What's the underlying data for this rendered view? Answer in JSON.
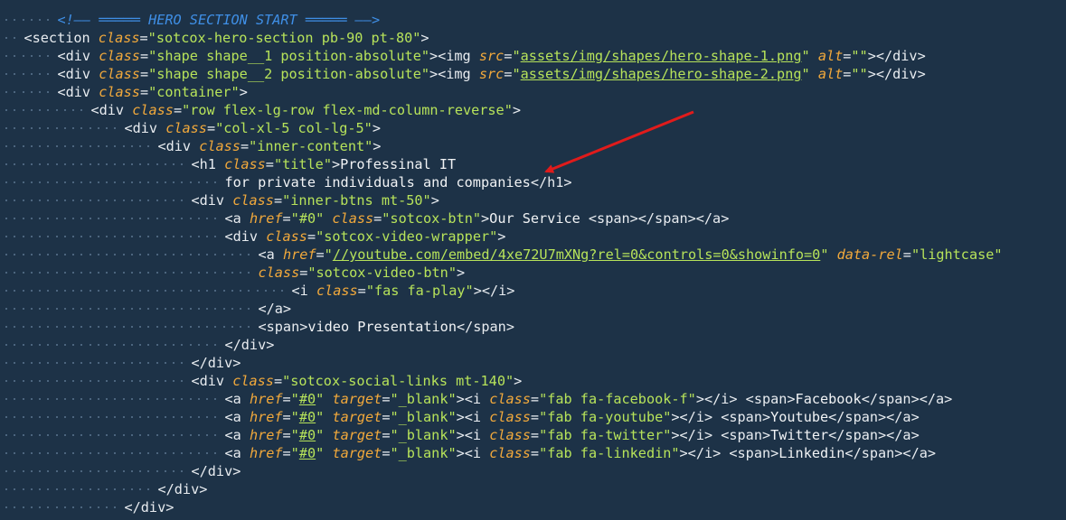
{
  "editor": {
    "lines": [
      [
        [
          "com",
          "<!—— ═════ HERO SECTION START ═════ ——>"
        ]
      ],
      [
        [
          "tag",
          "<section "
        ],
        [
          "attr",
          "class"
        ],
        [
          "tag",
          "="
        ],
        [
          "str",
          "\"sotcox-hero-section pb-90 pt-80\""
        ],
        [
          "tag",
          ">"
        ]
      ],
      [
        [
          "tag",
          "<div "
        ],
        [
          "attr",
          "class"
        ],
        [
          "tag",
          "="
        ],
        [
          "str",
          "\"shape shape__1 position-absolute\""
        ],
        [
          "tag",
          "><img "
        ],
        [
          "attr",
          "src"
        ],
        [
          "tag",
          "="
        ],
        [
          "str",
          "\""
        ],
        [
          "link",
          "assets/img/shapes/hero-shape-1.png"
        ],
        [
          "str",
          "\""
        ],
        [
          "tag",
          " "
        ],
        [
          "attr",
          "alt"
        ],
        [
          "tag",
          "="
        ],
        [
          "str",
          "\"\""
        ],
        [
          "tag",
          "></div>"
        ]
      ],
      [
        [
          "tag",
          "<div "
        ],
        [
          "attr",
          "class"
        ],
        [
          "tag",
          "="
        ],
        [
          "str",
          "\"shape shape__2 position-absolute\""
        ],
        [
          "tag",
          "><img "
        ],
        [
          "attr",
          "src"
        ],
        [
          "tag",
          "="
        ],
        [
          "str",
          "\""
        ],
        [
          "link",
          "assets/img/shapes/hero-shape-2.png"
        ],
        [
          "str",
          "\""
        ],
        [
          "tag",
          " "
        ],
        [
          "attr",
          "alt"
        ],
        [
          "tag",
          "="
        ],
        [
          "str",
          "\"\""
        ],
        [
          "tag",
          "></div>"
        ]
      ],
      [
        [
          "tag",
          "<div "
        ],
        [
          "attr",
          "class"
        ],
        [
          "tag",
          "="
        ],
        [
          "str",
          "\"container\""
        ],
        [
          "tag",
          ">"
        ]
      ],
      [
        [
          "tag",
          "<div "
        ],
        [
          "attr",
          "class"
        ],
        [
          "tag",
          "="
        ],
        [
          "str",
          "\"row flex-lg-row flex-md-column-reverse\""
        ],
        [
          "tag",
          ">"
        ]
      ],
      [
        [
          "tag",
          "<div "
        ],
        [
          "attr",
          "class"
        ],
        [
          "tag",
          "="
        ],
        [
          "str",
          "\"col-xl-5 col-lg-5\""
        ],
        [
          "tag",
          ">"
        ]
      ],
      [
        [
          "tag",
          "<div "
        ],
        [
          "attr",
          "class"
        ],
        [
          "tag",
          "="
        ],
        [
          "str",
          "\"inner-content\""
        ],
        [
          "tag",
          ">"
        ]
      ],
      [
        [
          "tag",
          "<h1 "
        ],
        [
          "attr",
          "class"
        ],
        [
          "tag",
          "="
        ],
        [
          "str",
          "\"title\""
        ],
        [
          "tag",
          ">"
        ],
        [
          "txt",
          "Professinal IT"
        ]
      ],
      [
        [
          "txt",
          "for private individuals and companies"
        ],
        [
          "tag",
          "</h1>"
        ]
      ],
      [
        [
          "tag",
          "<div "
        ],
        [
          "attr",
          "class"
        ],
        [
          "tag",
          "="
        ],
        [
          "str",
          "\"inner-btns mt-50\""
        ],
        [
          "tag",
          ">"
        ]
      ],
      [
        [
          "tag",
          "<a "
        ],
        [
          "attr",
          "href"
        ],
        [
          "tag",
          "="
        ],
        [
          "str",
          "\"#0\""
        ],
        [
          "tag",
          " "
        ],
        [
          "attr",
          "class"
        ],
        [
          "tag",
          "="
        ],
        [
          "str",
          "\"sotcox-btn\""
        ],
        [
          "tag",
          ">"
        ],
        [
          "txt",
          "Our Service "
        ],
        [
          "tag",
          "<span></span></a>"
        ]
      ],
      [
        [
          "tag",
          "<div "
        ],
        [
          "attr",
          "class"
        ],
        [
          "tag",
          "="
        ],
        [
          "str",
          "\"sotcox-video-wrapper\""
        ],
        [
          "tag",
          ">"
        ]
      ],
      [
        [
          "tag",
          "<a "
        ],
        [
          "attr",
          "href"
        ],
        [
          "tag",
          "="
        ],
        [
          "str",
          "\""
        ],
        [
          "link",
          "//youtube.com/embed/4xe72U7mXNg?rel=0&controls=0&showinfo=0"
        ],
        [
          "str",
          "\""
        ],
        [
          "tag",
          " "
        ],
        [
          "attr",
          "data-rel"
        ],
        [
          "tag",
          "="
        ],
        [
          "str",
          "\"lightcase\""
        ]
      ],
      [
        [
          "attr",
          "class"
        ],
        [
          "tag",
          "="
        ],
        [
          "str",
          "\"sotcox-video-btn\""
        ],
        [
          "tag",
          ">"
        ]
      ],
      [
        [
          "tag",
          "<i "
        ],
        [
          "attr",
          "class"
        ],
        [
          "tag",
          "="
        ],
        [
          "str",
          "\"fas fa-play\""
        ],
        [
          "tag",
          "></i>"
        ]
      ],
      [
        [
          "tag",
          "</a>"
        ]
      ],
      [
        [
          "tag",
          "<span>"
        ],
        [
          "txt",
          "video Presentation"
        ],
        [
          "tag",
          "</span>"
        ]
      ],
      [
        [
          "tag",
          "</div>"
        ]
      ],
      [
        [
          "tag",
          "</div>"
        ]
      ],
      [
        [
          "tag",
          "<div "
        ],
        [
          "attr",
          "class"
        ],
        [
          "tag",
          "="
        ],
        [
          "str",
          "\"sotcox-social-links mt-140\""
        ],
        [
          "tag",
          ">"
        ]
      ],
      [
        [
          "tag",
          "<a "
        ],
        [
          "attr",
          "href"
        ],
        [
          "tag",
          "="
        ],
        [
          "str",
          "\""
        ],
        [
          "link",
          "#0"
        ],
        [
          "str",
          "\""
        ],
        [
          "tag",
          " "
        ],
        [
          "attr",
          "target"
        ],
        [
          "tag",
          "="
        ],
        [
          "str",
          "\"_blank\""
        ],
        [
          "tag",
          "><i "
        ],
        [
          "attr",
          "class"
        ],
        [
          "tag",
          "="
        ],
        [
          "str",
          "\"fab fa-facebook-f\""
        ],
        [
          "tag",
          "></i> <span>"
        ],
        [
          "txt",
          "Facebook"
        ],
        [
          "tag",
          "</span></a>"
        ]
      ],
      [
        [
          "tag",
          "<a "
        ],
        [
          "attr",
          "href"
        ],
        [
          "tag",
          "="
        ],
        [
          "str",
          "\""
        ],
        [
          "link",
          "#0"
        ],
        [
          "str",
          "\""
        ],
        [
          "tag",
          " "
        ],
        [
          "attr",
          "target"
        ],
        [
          "tag",
          "="
        ],
        [
          "str",
          "\"_blank\""
        ],
        [
          "tag",
          "><i "
        ],
        [
          "attr",
          "class"
        ],
        [
          "tag",
          "="
        ],
        [
          "str",
          "\"fab fa-youtube\""
        ],
        [
          "tag",
          "></i> <span>"
        ],
        [
          "txt",
          "Youtube"
        ],
        [
          "tag",
          "</span></a>"
        ]
      ],
      [
        [
          "tag",
          "<a "
        ],
        [
          "attr",
          "href"
        ],
        [
          "tag",
          "="
        ],
        [
          "str",
          "\""
        ],
        [
          "link",
          "#0"
        ],
        [
          "str",
          "\""
        ],
        [
          "tag",
          " "
        ],
        [
          "attr",
          "target"
        ],
        [
          "tag",
          "="
        ],
        [
          "str",
          "\"_blank\""
        ],
        [
          "tag",
          "><i "
        ],
        [
          "attr",
          "class"
        ],
        [
          "tag",
          "="
        ],
        [
          "str",
          "\"fab fa-twitter\""
        ],
        [
          "tag",
          "></i> <span>"
        ],
        [
          "txt",
          "Twitter"
        ],
        [
          "tag",
          "</span></a>"
        ]
      ],
      [
        [
          "tag",
          "<a "
        ],
        [
          "attr",
          "href"
        ],
        [
          "tag",
          "="
        ],
        [
          "str",
          "\""
        ],
        [
          "link",
          "#0"
        ],
        [
          "str",
          "\""
        ],
        [
          "tag",
          " "
        ],
        [
          "attr",
          "target"
        ],
        [
          "tag",
          "="
        ],
        [
          "str",
          "\"_blank\""
        ],
        [
          "tag",
          "><i "
        ],
        [
          "attr",
          "class"
        ],
        [
          "tag",
          "="
        ],
        [
          "str",
          "\"fab fa-linkedin\""
        ],
        [
          "tag",
          "></i> <span>"
        ],
        [
          "txt",
          "Linkedin"
        ],
        [
          "tag",
          "</span></a>"
        ]
      ],
      [
        [
          "tag",
          "</div>"
        ]
      ],
      [
        [
          "tag",
          "</div>"
        ]
      ],
      [
        [
          "tag",
          "</div>"
        ]
      ]
    ],
    "indent_levels": [
      1,
      0,
      1,
      1,
      1,
      2,
      3,
      4,
      5,
      6,
      5,
      6,
      6,
      7,
      7,
      8,
      7,
      7,
      6,
      5,
      5,
      6,
      6,
      6,
      6,
      5,
      4,
      3
    ]
  },
  "colors": {
    "background": "#1d3247",
    "tag": "#e8ecf0",
    "attribute": "#f2a93b",
    "string": "#b7e35a",
    "text": "#f1f3f5",
    "comment": "#3f8fe6",
    "whitespace_dot": "#5b7690",
    "annotation_arrow": "#e01b1b"
  }
}
